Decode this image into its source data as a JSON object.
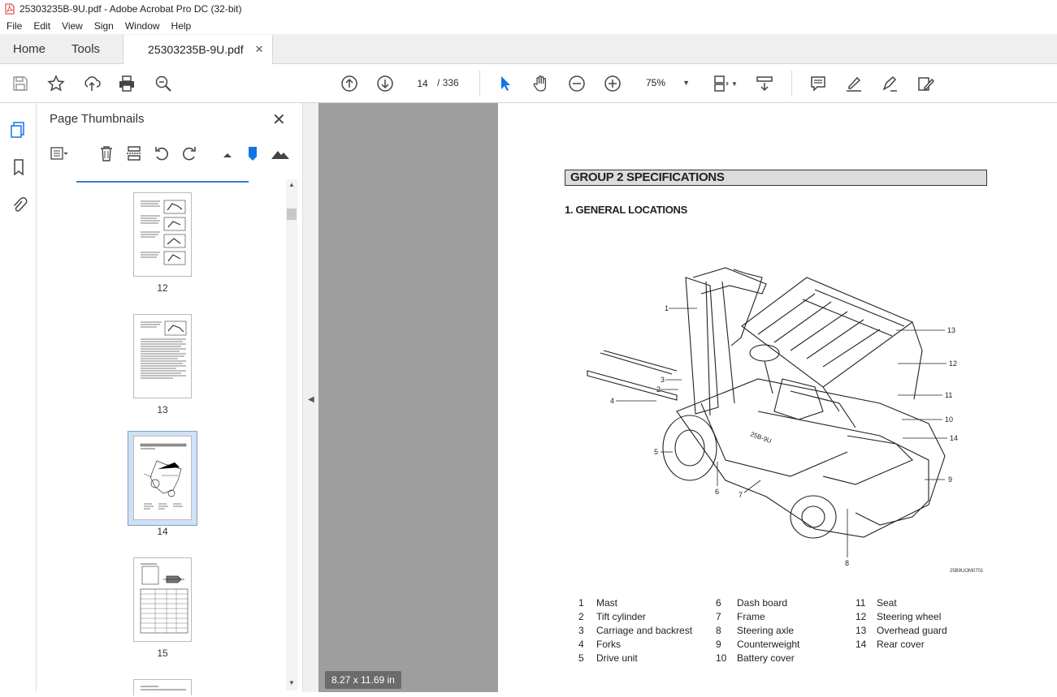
{
  "window": {
    "title": "25303235B-9U.pdf - Adobe Acrobat Pro DC (32-bit)"
  },
  "menu": [
    "File",
    "Edit",
    "View",
    "Sign",
    "Window",
    "Help"
  ],
  "tabs": {
    "home": "Home",
    "tools": "Tools",
    "document": "25303235B-9U.pdf"
  },
  "toolbar": {
    "page_current": "14",
    "page_total": "/ 336",
    "zoom": "75%"
  },
  "thumbnails_panel": {
    "title": "Page Thumbnails",
    "pages": [
      {
        "label": "12",
        "selected": false
      },
      {
        "label": "13",
        "selected": false
      },
      {
        "label": "14",
        "selected": true
      },
      {
        "label": "15",
        "selected": false
      }
    ]
  },
  "status": {
    "page_size": "8.27 x 11.69 in"
  },
  "document": {
    "group_heading": "GROUP 2  SPECIFICATIONS",
    "section_heading": "1. GENERAL LOCATIONS",
    "figure_code": "25B9UOM0701",
    "callouts": [
      "1",
      "2",
      "3",
      "4",
      "5",
      "6",
      "7",
      "8",
      "9",
      "10",
      "11",
      "12",
      "13",
      "14"
    ],
    "legend_columns": [
      [
        {
          "num": "1",
          "name": "Mast"
        },
        {
          "num": "2",
          "name": "Tift cylinder"
        },
        {
          "num": "3",
          "name": "Carriage and backrest"
        },
        {
          "num": "4",
          "name": "Forks"
        },
        {
          "num": "5",
          "name": "Drive unit"
        }
      ],
      [
        {
          "num": "6",
          "name": "Dash board"
        },
        {
          "num": "7",
          "name": "Frame"
        },
        {
          "num": "8",
          "name": "Steering axle"
        },
        {
          "num": "9",
          "name": "Counterweight"
        },
        {
          "num": "10",
          "name": "Battery cover"
        }
      ],
      [
        {
          "num": "11",
          "name": "Seat"
        },
        {
          "num": "12",
          "name": "Steering wheel"
        },
        {
          "num": "13",
          "name": "Overhead guard"
        },
        {
          "num": "14",
          "name": "Rear cover"
        }
      ]
    ],
    "truck_model_text": "25B-9U"
  },
  "colors": {
    "accent": "#3a7bd5",
    "viewer_bg": "#9e9e9e",
    "heading_fill": "#dcdcdc"
  }
}
